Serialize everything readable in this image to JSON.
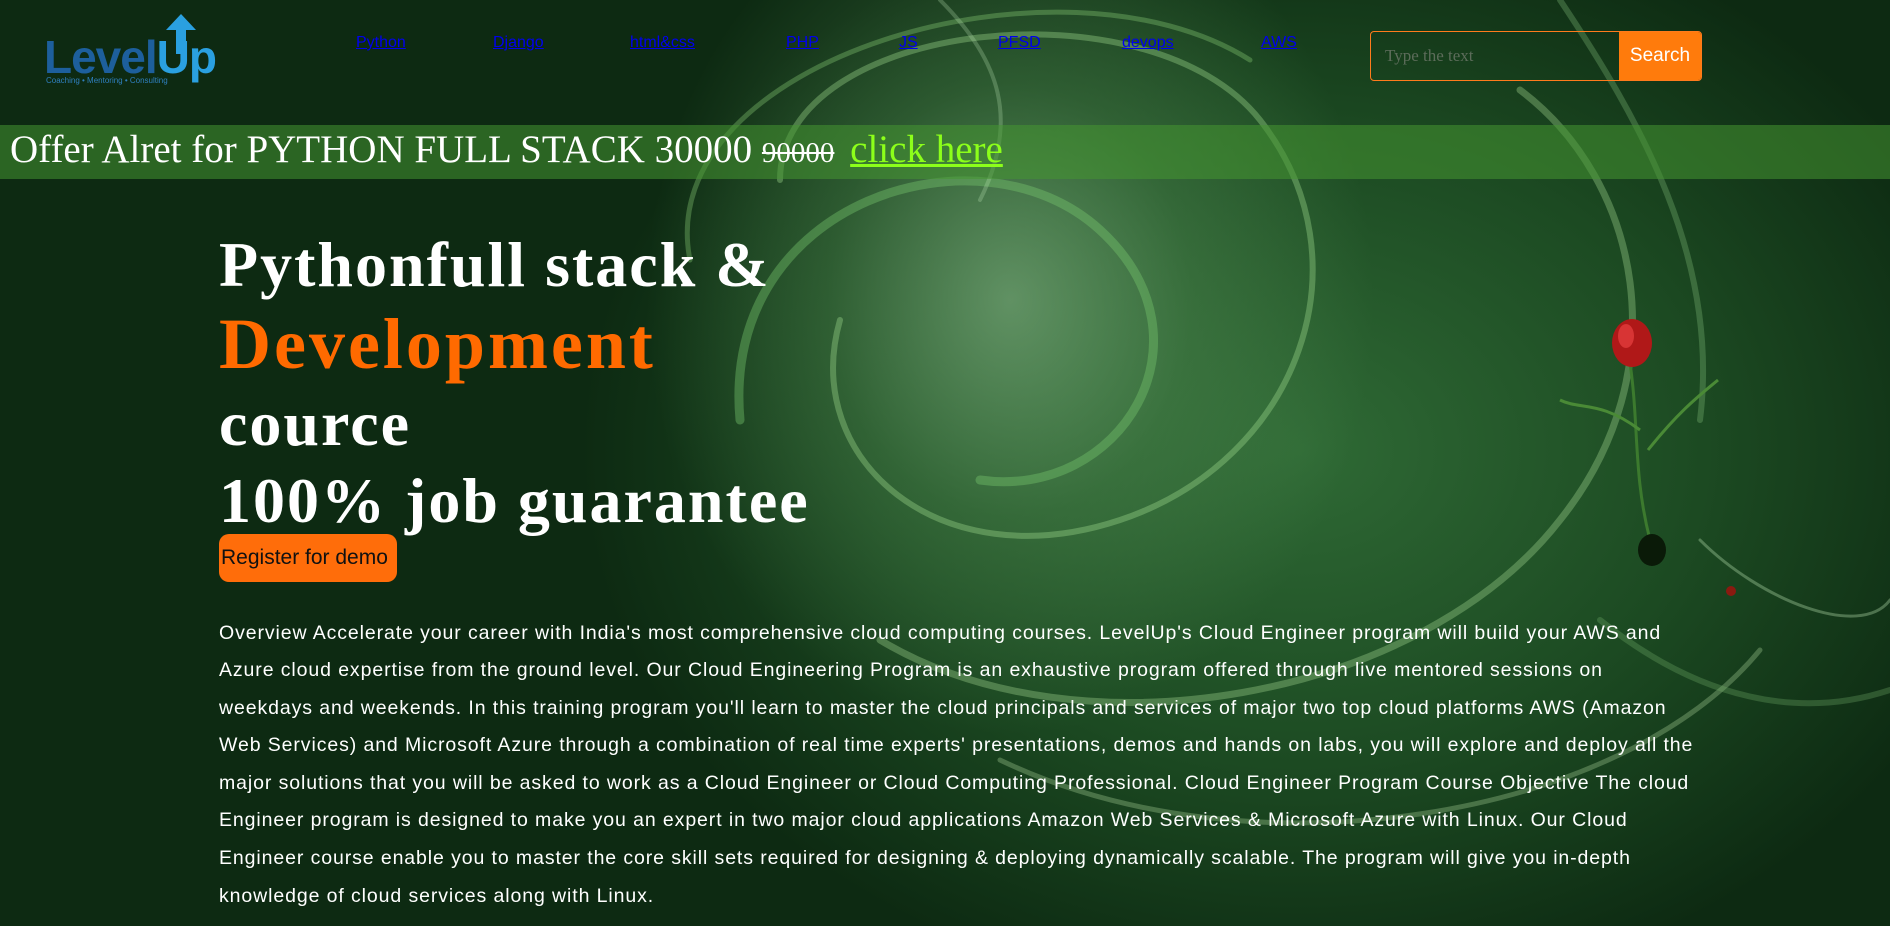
{
  "brand": {
    "logo_text_a": "Level",
    "logo_text_b": "p",
    "logo_tagline": "Coaching • Mentoring • Consulting",
    "color_primary": "#1d5f9c",
    "color_accent": "#2aa0e0"
  },
  "nav": {
    "items": [
      {
        "label": "Python"
      },
      {
        "label": "Django"
      },
      {
        "label": "html&css"
      },
      {
        "label": "PHP"
      },
      {
        "label": "JS"
      },
      {
        "label": "PFSD"
      },
      {
        "label": "devops"
      },
      {
        "label": "AWS"
      }
    ]
  },
  "search": {
    "placeholder": "Type the text",
    "button_label": "Search",
    "accent_color": "#ff7b0c"
  },
  "offer": {
    "text": "Offer Alret for PYTHON FULL STACK 30000 ",
    "old_price": "90000",
    "link_label": "click here",
    "link_color": "#8cff1a"
  },
  "hero": {
    "line1": "Pythonfull stack &",
    "line2": "Development",
    "line3": "cource",
    "line4": "100% job guarantee",
    "highlight_color": "#ff6a00"
  },
  "register_button": {
    "label": "Register for demo"
  },
  "overview": {
    "text": "Overview Accelerate your career with India's most comprehensive cloud computing courses. LevelUp's Cloud Engineer program will build your AWS and Azure cloud expertise from the ground level. Our Cloud Engineering Program is an exhaustive program offered through live mentored sessions on weekdays and weekends. In this training program you'll learn to master the cloud principals and services of major two top cloud platforms AWS (Amazon Web Services) and Microsoft Azure through a combination of real time experts' presentations, demos and hands on labs, you will explore and deploy all the major solutions that you will be asked to work as a Cloud Engineer or Cloud Computing Professional. Cloud Engineer Program Course Objective The cloud Engineer program is designed to make you an expert in two major cloud applications Amazon Web Services & Microsoft Azure with Linux. Our Cloud Engineer course enable you to master the core skill sets required for designing & deploying dynamically scalable. The program will give you in-depth knowledge of cloud services along with Linux."
  }
}
